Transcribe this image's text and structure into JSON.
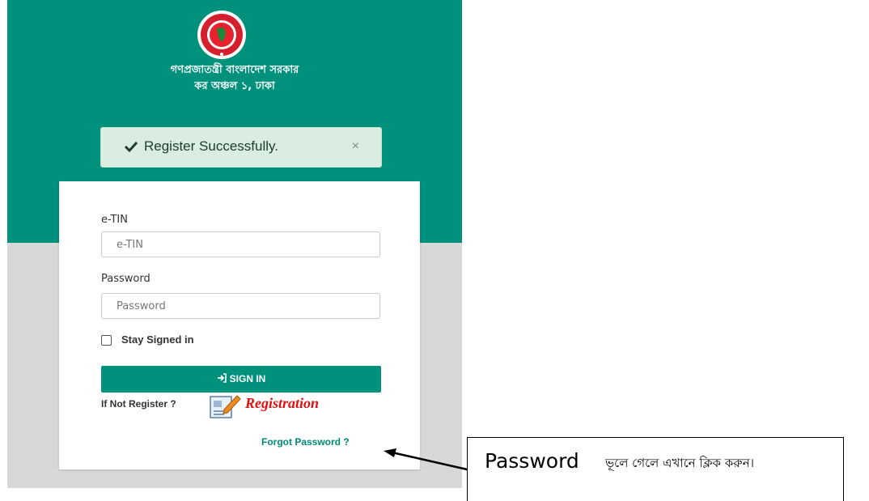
{
  "header": {
    "gov_title": "গণপ্রজাতন্ত্রী বাংলাদেশ সরকার",
    "gov_subtitle": "কর অঞ্চল ১, ঢাকা"
  },
  "alert": {
    "message": "Register Successfully.",
    "close": "×"
  },
  "form": {
    "etin_label": "e-TIN",
    "etin_placeholder": "e-TIN",
    "etin_value": "",
    "password_label": "Password",
    "password_placeholder": "Password",
    "password_value": "",
    "stay_signed_in": "Stay Signed in",
    "stay_signed_in_checked": false,
    "signin_label": "SIGN IN",
    "if_not_register": "If Not Register ?",
    "registration_link": "Registration",
    "forgot_password": "Forgot Password ?"
  },
  "annotation": {
    "word": "Password",
    "bengali_text": "ভূলে গেলে এখানে ক্লিক করুন।"
  },
  "colors": {
    "primary": "#00917c",
    "alert_bg": "#d9eee1",
    "registration": "#e01010"
  },
  "icons": [
    "government-seal-icon",
    "check-icon",
    "close-icon",
    "sign-in-icon",
    "registration-form-icon",
    "arrow-pointer-icon"
  ]
}
